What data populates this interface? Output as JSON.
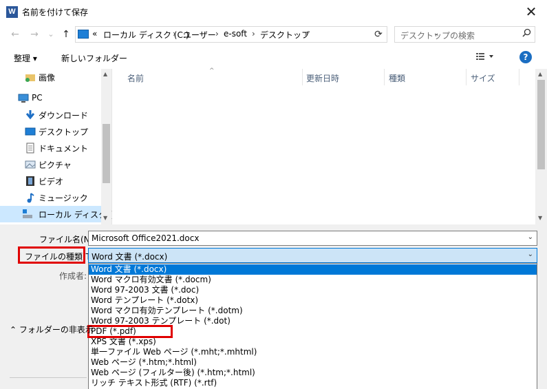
{
  "window": {
    "title": "名前を付けて保存",
    "app_icon": "W",
    "close_label": "✕"
  },
  "nav": {
    "back": "←",
    "forward": "→",
    "recent": "⌄",
    "up": "↑",
    "breadcrumbs": [
      "«",
      "ローカル ディスク (C:)",
      "ユーザー",
      "e-soft",
      "デスクトップ"
    ],
    "separator": "›",
    "search_placeholder": "デスクトップの検索"
  },
  "toolbar": {
    "organize": "整理 ▾",
    "new_folder": "新しいフォルダー",
    "help": "?"
  },
  "sidebar": {
    "items": [
      {
        "label": "画像",
        "icon": "pictures-folder-icon"
      },
      {
        "label": "PC",
        "icon": "pc-icon"
      },
      {
        "label": "ダウンロード",
        "icon": "download-icon"
      },
      {
        "label": "デスクトップ",
        "icon": "desktop-icon"
      },
      {
        "label": "ドキュメント",
        "icon": "documents-icon"
      },
      {
        "label": "ピクチャ",
        "icon": "pictures-icon"
      },
      {
        "label": "ビデオ",
        "icon": "video-icon"
      },
      {
        "label": "ミュージック",
        "icon": "music-icon"
      },
      {
        "label": "ローカル ディスク (C:",
        "icon": "drive-icon",
        "selected": true
      }
    ]
  },
  "filelist": {
    "columns": [
      "名前",
      "更新日時",
      "種類",
      "サイズ"
    ]
  },
  "form": {
    "filename_label": "ファイル名(N):",
    "filename_value": "Microsoft Office2021.docx",
    "filetype_label": "ファイルの種類(T):",
    "filetype_value": "Word 文書 (*.docx)",
    "author_label": "作成者:"
  },
  "filetype_options": [
    "Word 文書 (*.docx)",
    "Word マクロ有効文書 (*.docm)",
    "Word 97-2003 文書 (*.doc)",
    "Word テンプレート (*.dotx)",
    "Word マクロ有効テンプレート (*.dotm)",
    "Word 97-2003 テンプレート (*.dot)",
    "PDF (*.pdf)",
    "XPS 文書 (*.xps)",
    "単一ファイル Web ページ (*.mht;*.mhtml)",
    "Web ページ (*.htm;*.html)",
    "Web ページ (フィルター後) (*.htm;*.html)",
    "リッチ テキスト形式 (RTF) (*.rtf)"
  ],
  "hide_folders": "フォルダーの非表示",
  "colors": {
    "accent": "#0078d7",
    "highlight_box": "#e00000",
    "selected_bg": "#cce8ff"
  }
}
